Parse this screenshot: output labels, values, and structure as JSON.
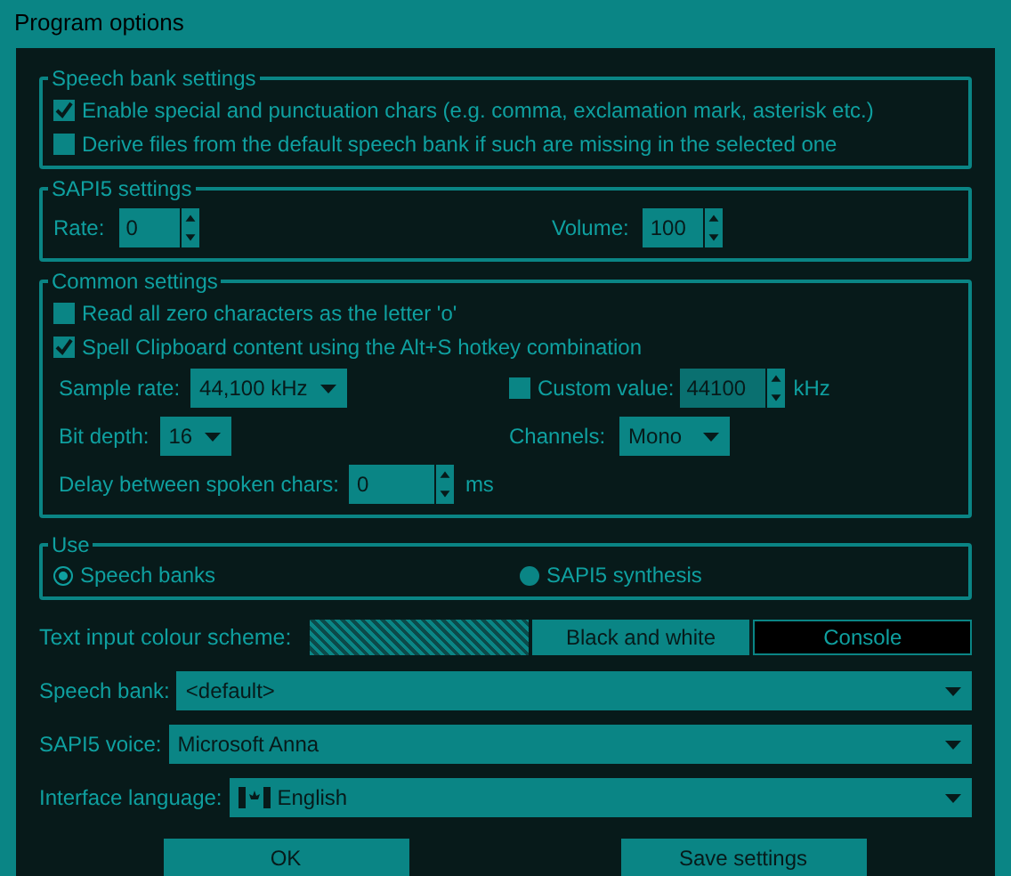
{
  "window": {
    "title": "Program options"
  },
  "speech_bank_settings": {
    "title": "Speech bank settings",
    "options": [
      {
        "label": "Enable special and punctuation chars (e.g. comma, exclamation mark, asterisk etc.)",
        "checked": true
      },
      {
        "label": "Derive files from the default speech bank if such are missing in the selected one",
        "checked": false
      }
    ]
  },
  "sapi5_settings": {
    "title": "SAPI5 settings",
    "rate": {
      "label": "Rate:",
      "value": "0"
    },
    "volume": {
      "label": "Volume:",
      "value": "100"
    }
  },
  "common_settings": {
    "title": "Common settings",
    "options": [
      {
        "label": "Read all zero characters as the letter 'o'",
        "checked": false
      },
      {
        "label": "Spell Clipboard content using the Alt+S hotkey combination",
        "checked": true
      }
    ],
    "sample_rate": {
      "label": "Sample rate:",
      "value": "44,100 kHz"
    },
    "custom_value": {
      "label": "Custom value:",
      "checked": false,
      "value": "44100",
      "unit": "kHz"
    },
    "bit_depth": {
      "label": "Bit depth:",
      "value": "16"
    },
    "channels": {
      "label": "Channels:",
      "value": "Mono"
    },
    "delay": {
      "label": "Delay between spoken chars:",
      "value": "0",
      "unit": "ms"
    }
  },
  "use": {
    "title": "Use",
    "options": [
      {
        "label": "Speech banks",
        "selected": true
      },
      {
        "label": "SAPI5 synthesis",
        "selected": false
      }
    ]
  },
  "colour_scheme": {
    "label": "Text input colour scheme:",
    "swatches": [
      {
        "kind": "pattern"
      },
      {
        "kind": "light",
        "label": "Black and white"
      },
      {
        "kind": "dark",
        "label": "Console"
      }
    ]
  },
  "speech_bank": {
    "label": "Speech bank:",
    "value": "<default>"
  },
  "sapi5_voice": {
    "label": "SAPI5 voice:",
    "value": "Microsoft Anna"
  },
  "interface_language": {
    "label": "Interface language:",
    "value": "English"
  },
  "buttons": [
    "OK",
    "Save settings"
  ]
}
